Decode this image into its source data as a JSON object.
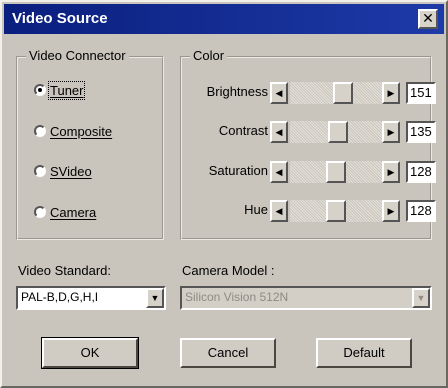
{
  "window": {
    "title": "Video Source"
  },
  "video_connector": {
    "legend": "Video Connector",
    "options": [
      {
        "label": "Tuner",
        "checked": true
      },
      {
        "label": "Composite",
        "checked": false
      },
      {
        "label": "SVideo",
        "checked": false
      },
      {
        "label": "Camera",
        "checked": false
      }
    ]
  },
  "color": {
    "legend": "Color",
    "rows": [
      {
        "label": "Brightness",
        "value": "151",
        "level": 151
      },
      {
        "label": "Contrast",
        "value": "135",
        "level": 135
      },
      {
        "label": "Saturation",
        "value": "128",
        "level": 128
      },
      {
        "label": "Hue",
        "value": "128",
        "level": 128
      }
    ],
    "range_max": 255
  },
  "video_standard": {
    "label": "Video Standard:",
    "value": "PAL-B,D,G,H,I"
  },
  "camera_model": {
    "label": "Camera Model :",
    "value": "Silicon Vision 512N",
    "disabled": true
  },
  "buttons": {
    "ok": "OK",
    "cancel": "Cancel",
    "default": "Default"
  }
}
